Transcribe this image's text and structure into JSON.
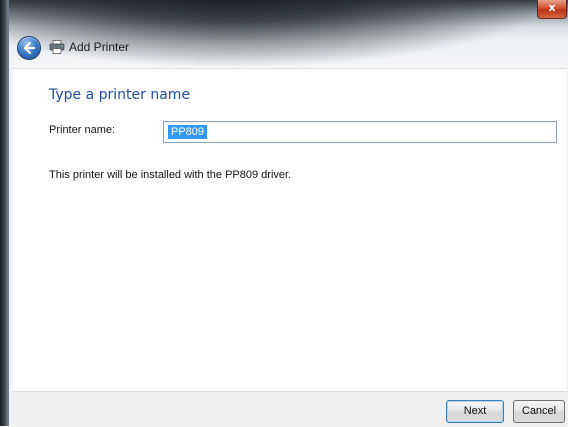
{
  "window": {
    "title": "Add Printer",
    "close_symbol": "x",
    "back_icon": "back-arrow-icon",
    "title_icon": "printer-icon"
  },
  "main": {
    "heading": "Type a printer name",
    "printer_name_label": "Printer name:",
    "printer_name_value": "PP809",
    "info_text": "This printer will be installed with the PP809 driver."
  },
  "footer": {
    "next_label": "Next",
    "cancel_label": "Cancel"
  },
  "colors": {
    "heading": "#1f4d9e",
    "selection": "#3399ff",
    "close_button": "#c8432a"
  }
}
